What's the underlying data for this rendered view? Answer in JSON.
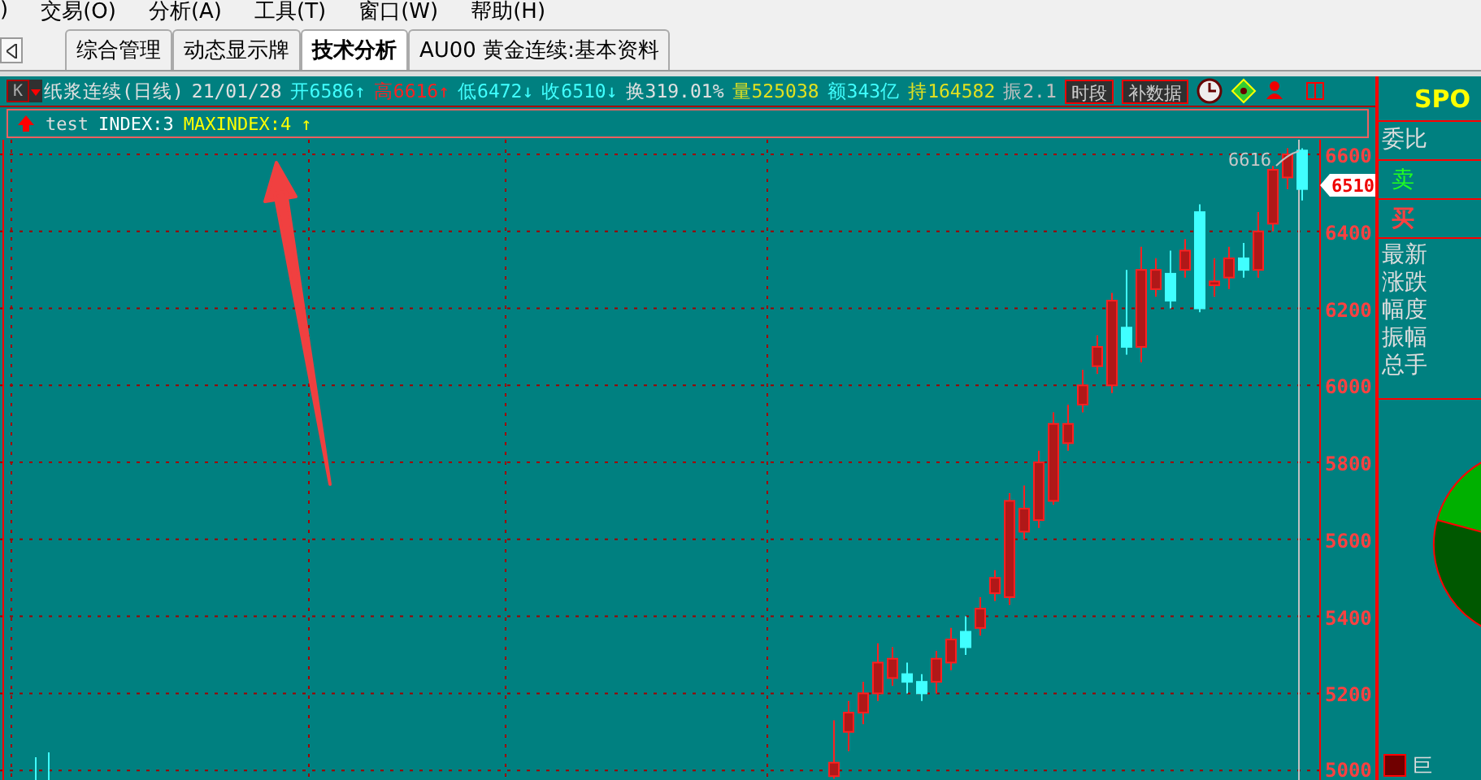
{
  "menu": [
    {
      "label": ")"
    },
    {
      "label": "交易(O)"
    },
    {
      "label": "分析(A)"
    },
    {
      "label": "工具(T)"
    },
    {
      "label": "窗口(W)"
    },
    {
      "label": "帮助(H)"
    }
  ],
  "tabs": [
    {
      "label": "综合管理",
      "selected": false
    },
    {
      "label": "动态显示牌",
      "selected": false
    },
    {
      "label": "技术分析",
      "selected": true
    },
    {
      "label": "AU00 黄金连续:基本资料",
      "selected": false
    }
  ],
  "quote_bar": {
    "period_button": "K",
    "fields": [
      {
        "text": "纸浆连续(日线)",
        "color": "#e0e0e0"
      },
      {
        "text": "21/01/28",
        "color": "#e0e0e0"
      },
      {
        "text": "开6586↑",
        "color": "#40ffff"
      },
      {
        "text": "高6616↑",
        "color": "#ff2020"
      },
      {
        "text": "低6472↓",
        "color": "#40ffff"
      },
      {
        "text": "收6510↓",
        "color": "#40ffff"
      },
      {
        "text": "换319.01%",
        "color": "#e0e0e0"
      },
      {
        "text": "量525038",
        "color": "#e0e020"
      },
      {
        "text": "额343亿",
        "color": "#40ffff"
      },
      {
        "text": "持164582",
        "color": "#e0e020"
      },
      {
        "text": "振2.1",
        "color": "#c0c0c0"
      }
    ],
    "buttons": [
      "时段",
      "补数据"
    ]
  },
  "indicator_bar": {
    "name": "test",
    "index": "INDEX:3",
    "max_index": "MAXINDEX:4",
    "arrow": "↑"
  },
  "chart": {
    "chart_data": {
      "type": "candlestick",
      "categories": [
        null,
        null,
        null,
        null,
        null,
        null,
        null,
        null,
        null,
        null,
        null,
        null,
        null,
        null,
        null,
        null,
        null,
        null,
        null,
        null,
        null,
        null,
        null,
        null,
        null,
        null,
        null,
        null,
        null,
        null,
        null,
        null,
        null
      ],
      "ohlc": [
        [
          4985,
          5130,
          4978,
          5020
        ],
        [
          5100,
          5180,
          5050,
          5150
        ],
        [
          5150,
          5230,
          5120,
          5200
        ],
        [
          5200,
          5330,
          5180,
          5280
        ],
        [
          5240,
          5320,
          5220,
          5290
        ],
        [
          5250,
          5280,
          5200,
          5230
        ],
        [
          5230,
          5250,
          5180,
          5200
        ],
        [
          5230,
          5310,
          5200,
          5290
        ],
        [
          5280,
          5370,
          5260,
          5340
        ],
        [
          5360,
          5400,
          5300,
          5320
        ],
        [
          5370,
          5450,
          5350,
          5420
        ],
        [
          5460,
          5520,
          5440,
          5500
        ],
        [
          5450,
          5720,
          5430,
          5700
        ],
        [
          5620,
          5740,
          5600,
          5680
        ],
        [
          5650,
          5830,
          5630,
          5800
        ],
        [
          5700,
          5930,
          5690,
          5900
        ],
        [
          5850,
          5950,
          5830,
          5900
        ],
        [
          5950,
          6040,
          5930,
          6000
        ],
        [
          6050,
          6130,
          6030,
          6100
        ],
        [
          6000,
          6240,
          5980,
          6220
        ],
        [
          6150,
          6300,
          6080,
          6100
        ],
        [
          6100,
          6360,
          6060,
          6300
        ],
        [
          6250,
          6330,
          6230,
          6300
        ],
        [
          6290,
          6350,
          6200,
          6220
        ],
        [
          6300,
          6380,
          6280,
          6350
        ],
        [
          6450,
          6470,
          6190,
          6200
        ],
        [
          6260,
          6330,
          6230,
          6270
        ],
        [
          6280,
          6360,
          6250,
          6330
        ],
        [
          6330,
          6370,
          6280,
          6300
        ],
        [
          6300,
          6450,
          6280,
          6400
        ],
        [
          6420,
          6570,
          6400,
          6560
        ],
        [
          6540,
          6616,
          6510,
          6600
        ],
        [
          6610,
          6616,
          6480,
          6510
        ]
      ],
      "grid": true,
      "ylim": [
        4975,
        6638
      ],
      "yticks": [
        6600,
        6400,
        6200,
        6000,
        5800,
        5600,
        5400,
        5200,
        5000
      ]
    },
    "high_label": "6616",
    "price_tag": "6510"
  },
  "side_panel": {
    "title": "SPO",
    "ratio_label": "委比",
    "sell_label": "卖",
    "buy_label": "买",
    "stats": [
      "最新",
      "涨跌",
      "幅度",
      "振幅",
      "总手"
    ],
    "legend_label": "巨"
  }
}
